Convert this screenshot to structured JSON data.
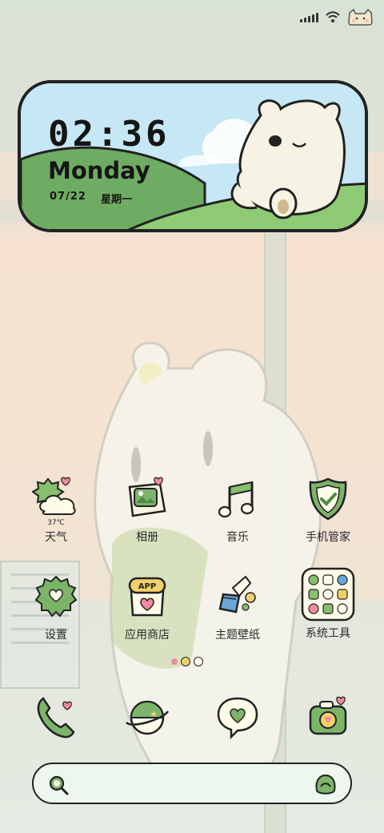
{
  "clock": {
    "time": "02:36",
    "day": "Monday",
    "date": "07/22",
    "weekday": "星期一"
  },
  "weather": {
    "temp": "37℃"
  },
  "apps_row1": [
    {
      "label": "天气",
      "icon": "weather-icon"
    },
    {
      "label": "相册",
      "icon": "gallery-icon"
    },
    {
      "label": "音乐",
      "icon": "music-icon"
    },
    {
      "label": "手机管家",
      "icon": "security-icon"
    }
  ],
  "apps_row2": [
    {
      "label": "设置",
      "icon": "settings-icon"
    },
    {
      "label": "应用商店",
      "icon": "app-store-icon",
      "badge": "APP"
    },
    {
      "label": "主题壁纸",
      "icon": "theme-icon"
    },
    {
      "label": "系统工具",
      "icon": "tools-folder-icon"
    }
  ],
  "dock": [
    {
      "icon": "phone-icon"
    },
    {
      "icon": "browser-icon"
    },
    {
      "icon": "messages-icon"
    },
    {
      "icon": "camera-icon"
    }
  ],
  "colors": {
    "accent_green": "#7cb46a",
    "outline": "#222222",
    "heart_pink": "#f08aa0",
    "sky": "#bfe4f2"
  }
}
